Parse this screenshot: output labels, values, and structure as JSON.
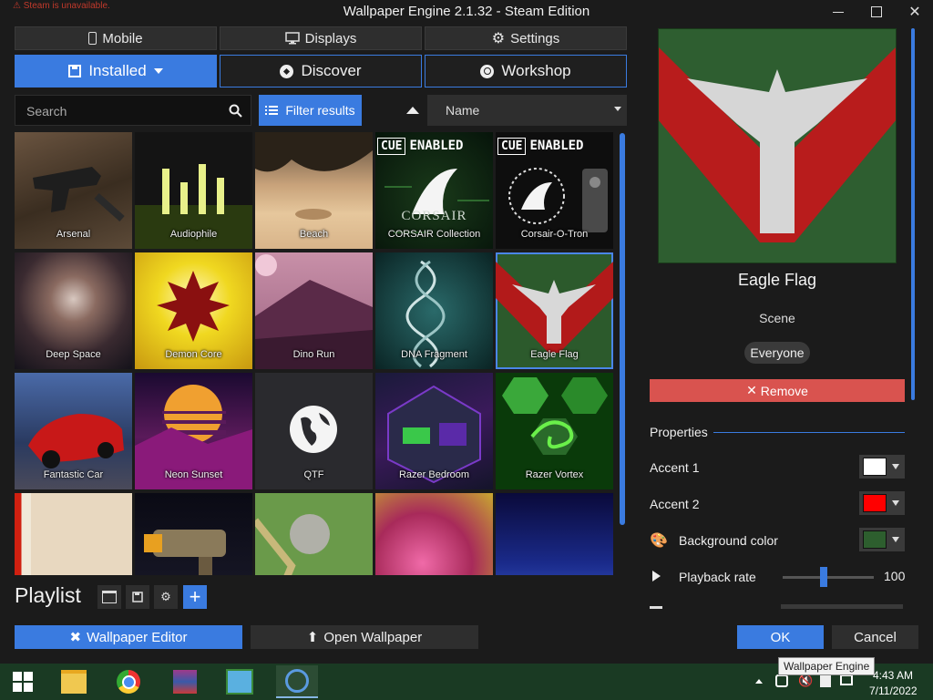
{
  "window": {
    "title": "Wallpaper Engine 2.1.32 - Steam Edition",
    "steam_warning": "Steam is unavailable."
  },
  "tabs_small": [
    {
      "label": "Mobile",
      "icon": "mobile-icon"
    },
    {
      "label": "Displays",
      "icon": "monitor-icon"
    },
    {
      "label": "Settings",
      "icon": "gear-icon"
    }
  ],
  "tabs_big": [
    {
      "label": "Installed",
      "icon": "save-icon",
      "active": true
    },
    {
      "label": "Discover",
      "icon": "compass-icon"
    },
    {
      "label": "Workshop",
      "icon": "steam-icon"
    }
  ],
  "toolbar": {
    "search_placeholder": "Search",
    "filter_label": "Filter results",
    "sort_label": "Name"
  },
  "wallpapers": [
    {
      "name": "Arsenal"
    },
    {
      "name": "Audiophile"
    },
    {
      "name": "Beach"
    },
    {
      "name": "CORSAIR Collection",
      "badge": "CUE ENABLED"
    },
    {
      "name": "Corsair-O-Tron",
      "badge": "CUE ENABLED"
    },
    {
      "name": "Deep Space"
    },
    {
      "name": "Demon Core"
    },
    {
      "name": "Dino Run"
    },
    {
      "name": "DNA Fragment"
    },
    {
      "name": "Eagle Flag",
      "selected": true
    },
    {
      "name": "Fantastic Car"
    },
    {
      "name": "Neon Sunset"
    },
    {
      "name": "QTF"
    },
    {
      "name": "Razer Bedroom"
    },
    {
      "name": "Razer Vortex"
    },
    {
      "name": ""
    },
    {
      "name": ""
    },
    {
      "name": ""
    },
    {
      "name": ""
    },
    {
      "name": ""
    }
  ],
  "cue": {
    "box": "CUE",
    "word": "ENABLED",
    "brand": "CORSAIR"
  },
  "playlist": {
    "title": "Playlist"
  },
  "bottom": {
    "editor_label": "Wallpaper Editor",
    "open_label": "Open Wallpaper",
    "ok_label": "OK",
    "cancel_label": "Cancel"
  },
  "details": {
    "title": "Eagle Flag",
    "type": "Scene",
    "rating": "Everyone",
    "remove_label": "Remove"
  },
  "properties": {
    "title": "Properties",
    "accent1": {
      "label": "Accent 1",
      "color": "#ffffff"
    },
    "accent2": {
      "label": "Accent 2",
      "color": "#ff0000"
    },
    "background": {
      "label": "Background color",
      "color": "#2d5e2e"
    },
    "playback": {
      "label": "Playback rate",
      "value": "100",
      "level": 0.45
    }
  },
  "taskbar": {
    "tooltip": "Wallpaper Engine",
    "time": "4:43 AM",
    "date": "7/11/2022"
  }
}
